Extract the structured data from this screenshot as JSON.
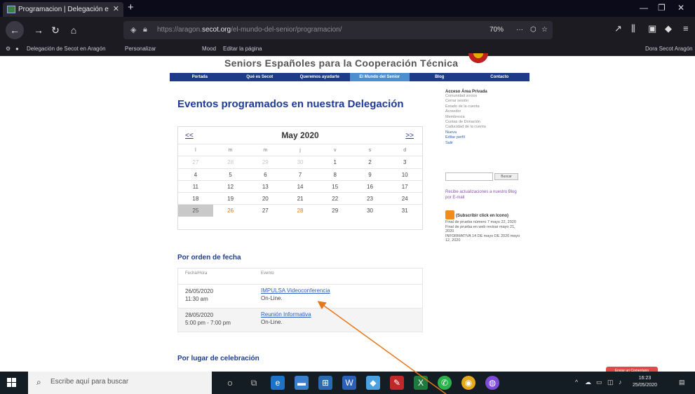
{
  "browser": {
    "tab_title": "Programacion | Delegación e",
    "tab_close": "✕",
    "new_tab": "+",
    "url_prefix": "https://aragon.",
    "url_domain": "secot.org",
    "url_suffix": "/el-mundo-del-senior/programacion/",
    "zoom": "70%",
    "url_menu": "···",
    "bookmarks": [
      "Delegación de Secot en Aragón",
      "Personalizar",
      "Mood",
      "Editar la página"
    ],
    "bookmarks_right": "Dora Secot Aragón"
  },
  "site": {
    "title": "Seniors Españoles para la Cooperación Técnica",
    "menu": [
      {
        "label": "Portada",
        "active": false
      },
      {
        "label": "Qué es Secot",
        "active": false
      },
      {
        "label": "Queremos ayudarte",
        "active": false
      },
      {
        "label": "El Mundo del Senior",
        "active": true
      },
      {
        "label": "Blog",
        "active": false
      },
      {
        "label": "Contacto",
        "active": false
      }
    ]
  },
  "main": {
    "heading": "Eventos programados en nuestra Delegación",
    "calendar": {
      "prev": "<<",
      "next": ">>",
      "month": "May 2020",
      "weekdays": [
        "l",
        "m",
        "m",
        "j",
        "v",
        "s",
        "d"
      ],
      "weeks": [
        [
          {
            "d": "27",
            "s": "muted"
          },
          {
            "d": "28",
            "s": "muted"
          },
          {
            "d": "29",
            "s": "muted"
          },
          {
            "d": "30",
            "s": "muted"
          },
          {
            "d": "1",
            "s": ""
          },
          {
            "d": "2",
            "s": ""
          },
          {
            "d": "3",
            "s": ""
          }
        ],
        [
          {
            "d": "4",
            "s": ""
          },
          {
            "d": "5",
            "s": ""
          },
          {
            "d": "6",
            "s": ""
          },
          {
            "d": "7",
            "s": ""
          },
          {
            "d": "8",
            "s": ""
          },
          {
            "d": "9",
            "s": ""
          },
          {
            "d": "10",
            "s": ""
          }
        ],
        [
          {
            "d": "11",
            "s": ""
          },
          {
            "d": "12",
            "s": ""
          },
          {
            "d": "13",
            "s": ""
          },
          {
            "d": "14",
            "s": ""
          },
          {
            "d": "15",
            "s": ""
          },
          {
            "d": "16",
            "s": ""
          },
          {
            "d": "17",
            "s": ""
          }
        ],
        [
          {
            "d": "18",
            "s": ""
          },
          {
            "d": "19",
            "s": ""
          },
          {
            "d": "20",
            "s": ""
          },
          {
            "d": "21",
            "s": ""
          },
          {
            "d": "22",
            "s": ""
          },
          {
            "d": "23",
            "s": ""
          },
          {
            "d": "24",
            "s": ""
          }
        ],
        [
          {
            "d": "25",
            "s": "today"
          },
          {
            "d": "26",
            "s": "event"
          },
          {
            "d": "27",
            "s": ""
          },
          {
            "d": "28",
            "s": "event"
          },
          {
            "d": "29",
            "s": ""
          },
          {
            "d": "30",
            "s": ""
          },
          {
            "d": "31",
            "s": ""
          }
        ]
      ]
    },
    "by_date_heading": "Por orden de fecha",
    "events_header": {
      "date": "Fecha/Hora",
      "event": "Evento"
    },
    "events": [
      {
        "date": "26/05/2020",
        "time": "11:30 am",
        "title": "IMPULSA Videoconferencia",
        "place": "On-Line."
      },
      {
        "date": "28/05/2020",
        "time": "5:00 pm - 7:00 pm",
        "title": "Reunión Informativa",
        "place": "On-Line."
      }
    ],
    "by_place_heading": "Por lugar de celebración"
  },
  "sidebar": {
    "heading": "Acceso Área Privada",
    "links": [
      "Comunidad socios",
      "Cerrar sesión",
      "Estado de la cuenta",
      "Acreedor",
      "Membresía",
      "Cuotas de Donación",
      "Caducidad de la cuenta",
      "Nueva",
      "Editar perfil",
      "Salir"
    ],
    "search_button": "Buscar",
    "blog_text": "Recibe actualizaciones a nuestro Blog por E-mail",
    "rss_title": "(Subscribir click en Icono)",
    "rss_items": [
      "Final de prueba número 7 mayo 22, 2020",
      "Final de prueba en web revisar mayo 21, 2020",
      "INFORMATIVA 14 DE mayo DE 2020 mayo 12, 2020"
    ],
    "feedback": "Enviar un Comentario"
  },
  "taskbar": {
    "search_placeholder": "Escribe aquí para buscar",
    "time": "16:23",
    "date": "25/05/2020"
  },
  "colors": {
    "brand_blue": "#1e3b8a",
    "heading_blue": "#1f3c95",
    "event_orange": "#e07a1a",
    "annotation_arrow": "#e8771a"
  }
}
